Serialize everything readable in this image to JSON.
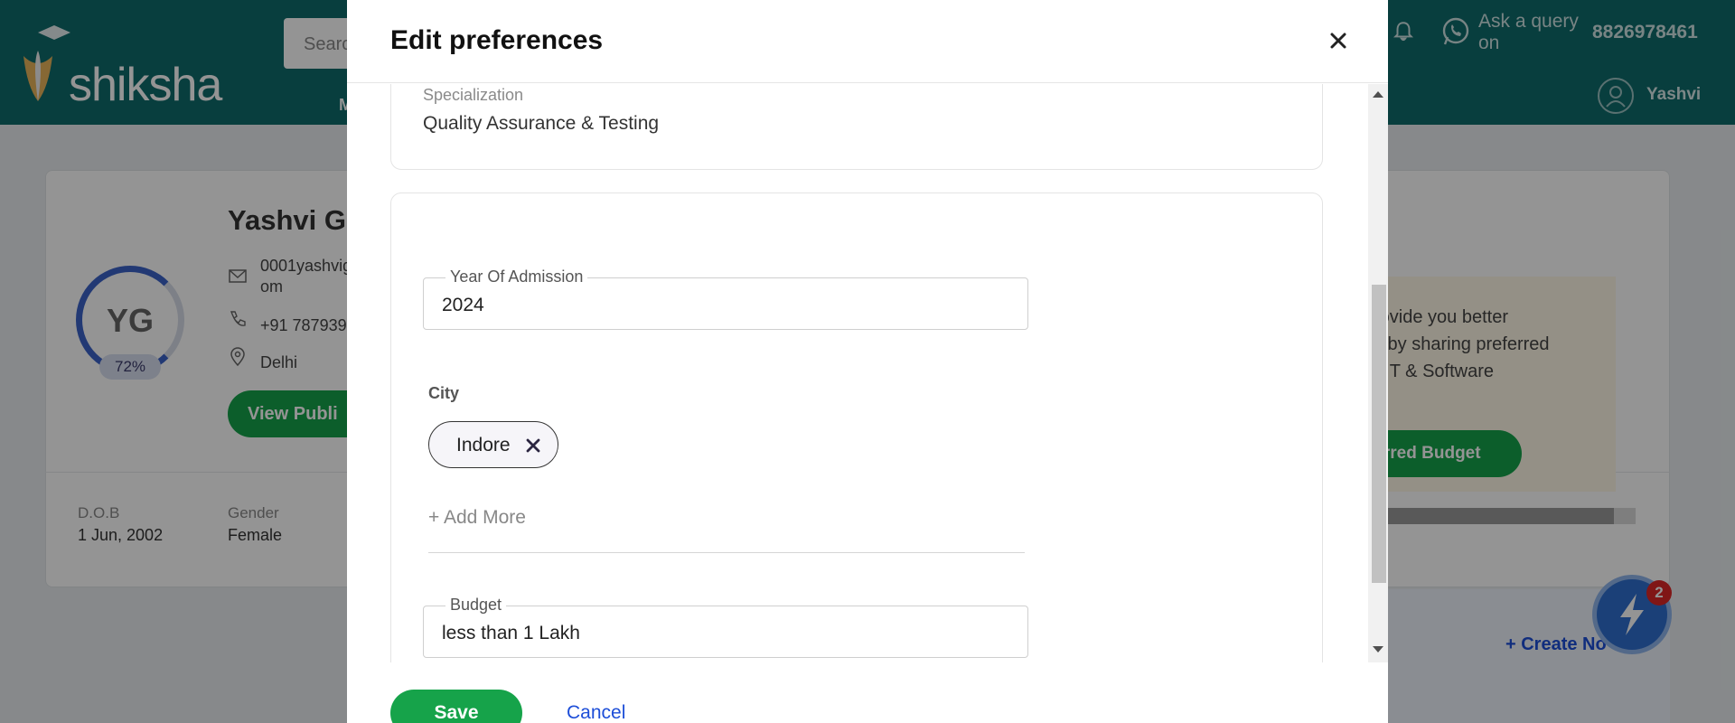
{
  "background": {
    "logo_text": "shiksha",
    "search_placeholder": "Searc",
    "nav_fragment": "M",
    "ask_query": "Ask a query on",
    "phone": "8826978461",
    "user_name": "Yashvi",
    "profile": {
      "name": "Yashvi Gu",
      "initials": "YG",
      "completion": "72%",
      "email_line1": "0001yashvig",
      "email_line2": "om",
      "phone": "+91 787939",
      "city": "Delhi",
      "view_button": "View Publi",
      "dob_label": "D.O.B",
      "dob_value": "1 Jun, 2002",
      "gender_label": "Gender",
      "gender_value": "Female"
    },
    "promo": {
      "line1": "rovide you better",
      "line2": "s by sharing preferred",
      "line3": "r IT & Software",
      "button": "ferred Budget"
    },
    "create_link": "+ Create No",
    "notification_count": "2"
  },
  "modal": {
    "title": "Edit preferences",
    "specialization": {
      "label": "Specialization",
      "value": "Quality Assurance & Testing"
    },
    "year_of_admission": {
      "label": "Year Of Admission",
      "value": "2024"
    },
    "city": {
      "label": "City",
      "chips": [
        {
          "label": "Indore"
        }
      ],
      "add_more": "+ Add More"
    },
    "budget": {
      "label": "Budget",
      "value": "less than 1 Lakh"
    },
    "save_label": "Save",
    "cancel_label": "Cancel"
  },
  "colors": {
    "header_bg": "#0e6b6b",
    "primary_green": "#16a34a",
    "link_blue": "#1d4ed8"
  }
}
